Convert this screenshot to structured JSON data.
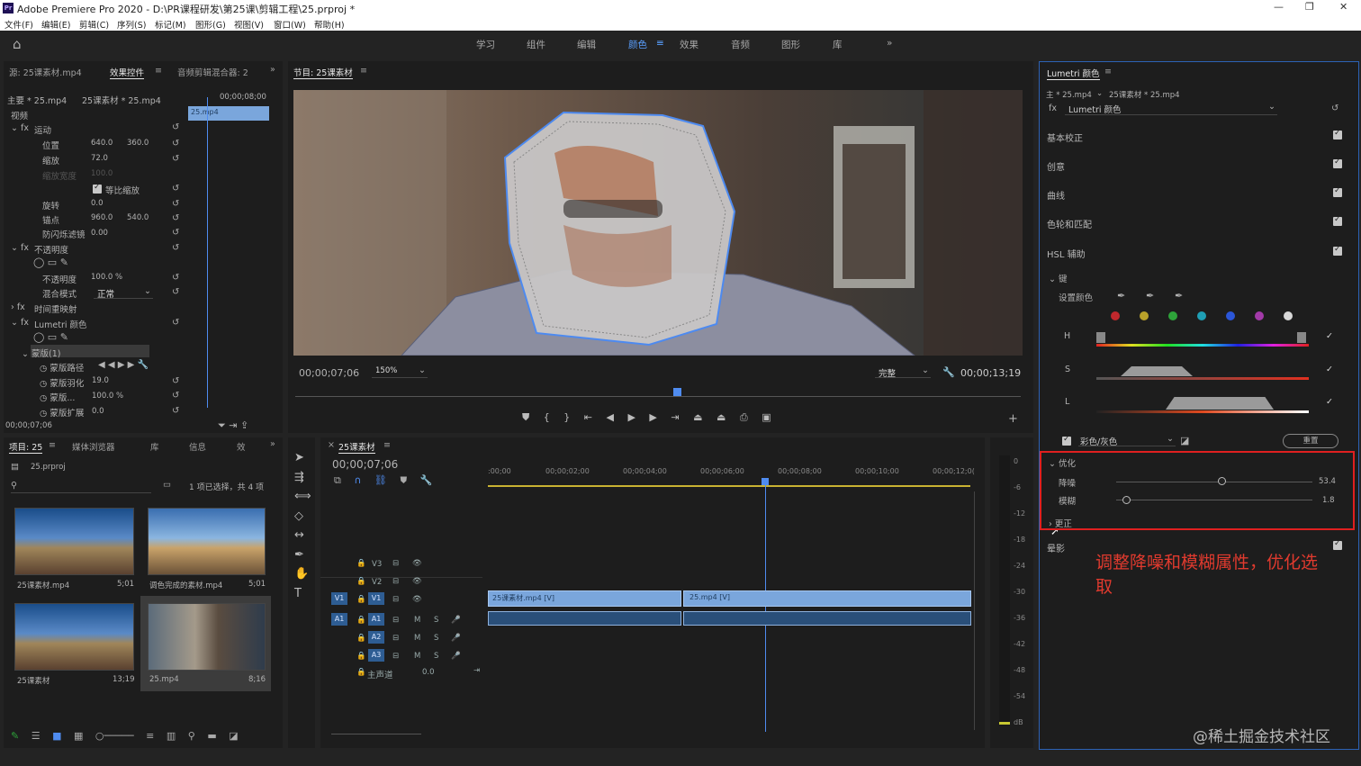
{
  "titlebar": {
    "title": "Adobe Premiere Pro 2020 - D:\\PR课程研发\\第25课\\剪辑工程\\25.prproj *",
    "logo": "Pr"
  },
  "menu": [
    "文件(F)",
    "编辑(E)",
    "剪辑(C)",
    "序列(S)",
    "标记(M)",
    "图形(G)",
    "视图(V)",
    "窗口(W)",
    "帮助(H)"
  ],
  "workspaces": [
    "学习",
    "组件",
    "编辑",
    "颜色",
    "效果",
    "音频",
    "图形",
    "库"
  ],
  "active_workspace": "颜色",
  "effect_controls": {
    "tabs": [
      "源: 25课素材.mp4",
      "效果控件",
      "音频剪辑混合器: 2"
    ],
    "master": "主要 * 25.mp4",
    "clip": "25课素材 * 25.mp4",
    "time": "00;00;08;00",
    "clip_label": "25.mp4",
    "section_video": "视频",
    "motion": "运动",
    "position": "位置",
    "pos_x": "640.0",
    "pos_y": "360.0",
    "scale": "缩放",
    "scale_v": "72.0",
    "scale_w": "缩放宽度",
    "scale_w_v": "100.0",
    "uniform": "等比缩放",
    "rotation": "旋转",
    "rotation_v": "0.0",
    "anchor": "锚点",
    "anchor_x": "960.0",
    "anchor_y": "540.0",
    "flicker": "防闪烁滤镜",
    "flicker_v": "0.00",
    "opacity": "不透明度",
    "opacity_p": "不透明度",
    "opacity_v": "100.0 %",
    "blend": "混合模式",
    "blend_v": "正常",
    "remap": "时间重映射",
    "lumetri": "Lumetri 颜色",
    "mask": "蒙版(1)",
    "mask_path": "蒙版路径",
    "mask_feather": "蒙版羽化",
    "mask_feather_v": "19.0",
    "mask_opacity": "蒙版...",
    "mask_opacity_v": "100.0 %",
    "mask_expand": "蒙版扩展",
    "mask_expand_v": "0.0",
    "footer_time": "00;00;07;06"
  },
  "program": {
    "tab": "节目: 25课素材",
    "timecode": "00;00;07;06",
    "zoom": "150%",
    "quality": "完整",
    "duration": "00;00;13;19"
  },
  "lumetri": {
    "tab": "Lumetri 颜色",
    "master": "主 * 25.mp4",
    "clip": "25课素材 * 25.mp4",
    "fx_select": "Lumetri 颜色",
    "sections": [
      "基本校正",
      "创意",
      "曲线",
      "色轮和匹配",
      "HSL 辅助"
    ],
    "key": "键",
    "set_color": "设置颜色",
    "H": "H",
    "S": "S",
    "L": "L",
    "swatch_colors": [
      "#c0282d",
      "#b9a12a",
      "#2ea33a",
      "#1f9fb5",
      "#2b56d8",
      "#a23aa8",
      "#d8d8d8"
    ],
    "mode": "彩色/灰色",
    "reset": "重置",
    "refine": "优化",
    "denoise": "降噪",
    "denoise_v": "53.4",
    "blur": "模糊",
    "blur_v": "1.8",
    "correct": "更正",
    "vignette": "晕影"
  },
  "project": {
    "tabs": [
      "项目: 25",
      "媒体浏览器",
      "库",
      "信息",
      "效"
    ],
    "file": "25.prproj",
    "count": "1 项已选择，共 4 项",
    "items": [
      {
        "name": "25课素材.mp4",
        "dur": "5;01"
      },
      {
        "name": "调色完成的素材.mp4",
        "dur": "5;01"
      },
      {
        "name": "25课素材",
        "dur": "13;19"
      },
      {
        "name": "25.mp4",
        "dur": "8;16"
      }
    ]
  },
  "timeline": {
    "tab": "25课素材",
    "timecode": "00;00;07;06",
    "ticks": [
      ":00;00",
      "00;00;02;00",
      "00;00;04;00",
      "00;00;06;00",
      "00;00;08;00",
      "00;00;10;00",
      "00;00;12;0("
    ],
    "tracks": [
      "V3",
      "V2",
      "V1",
      "A1",
      "A2",
      "A3"
    ],
    "v1_label": "V1",
    "a1_label": "A1",
    "master": "主声道",
    "master_v": "0.0",
    "clip1": "25课素材.mp4 [V]",
    "clip2": "25.mp4 [V]"
  },
  "meter_ticks": [
    "0",
    "-6",
    "-12",
    "-18",
    "-24",
    "-30",
    "-36",
    "-42",
    "-48",
    "-54",
    "dB"
  ],
  "annotation": "调整降噪和模糊属性，优化选取",
  "watermark": "@稀土掘金技术社区"
}
